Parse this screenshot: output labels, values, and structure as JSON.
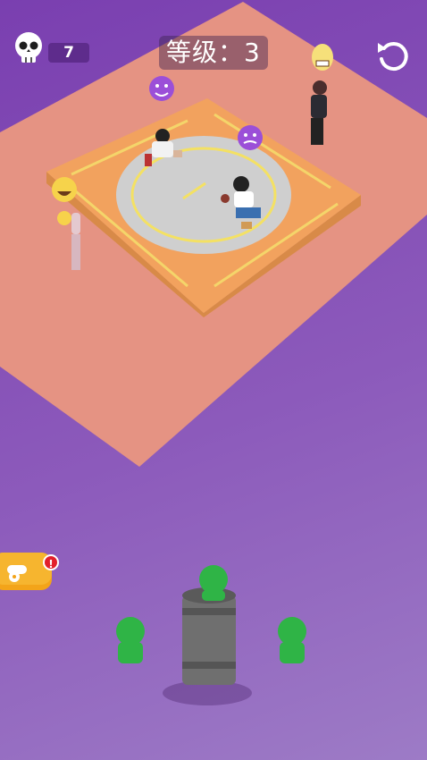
{
  "hud": {
    "kills": "7",
    "level_text": "等级：3",
    "skull_icon": "skull-icon",
    "restart_icon": "restart-icon"
  },
  "cannon_button": {
    "icon": "cannon-icon",
    "badge": "!"
  },
  "colors": {
    "background": "#8c5abb",
    "platform": "#e59383",
    "ring_base": "#f2a25e",
    "ring_line": "#f4e163",
    "arena_floor": "#cfcfcf",
    "player_green": "#2fb446",
    "barrel": "#6f6f6f",
    "badge_red": "#e2202b"
  },
  "characters": {
    "enemy_emoji": "angry-devil-emoji",
    "laughing_emoji": "laughing-emoji",
    "nervous_emoji": "grimacing-emoji"
  }
}
